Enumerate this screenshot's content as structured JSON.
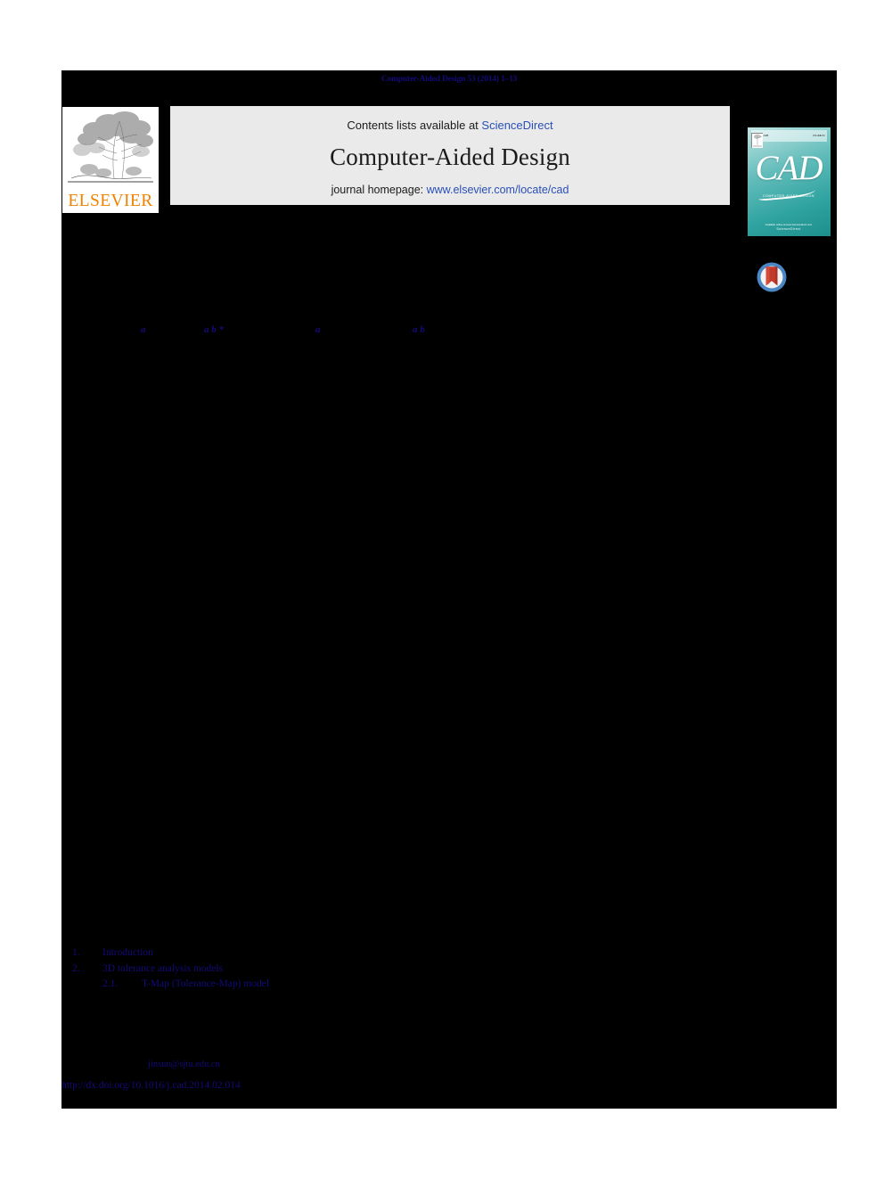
{
  "running_head": "Computer-Aided Design 53 (2014) 1–13",
  "masthead": {
    "contents_prefix": "Contents lists available at ",
    "sciencedirect_link": "ScienceDirect",
    "journal_title": "Computer-Aided Design",
    "homepage_prefix": "journal homepage: ",
    "homepage_link": "www.elsevier.com/locate/cad",
    "elsevier_wordmark": "ELSEVIER",
    "elsevier_logo_icon": "elsevier-tree-icon"
  },
  "cad_cover": {
    "title": "CAD",
    "subtitle": "COMPUTER-AIDED DESIGN",
    "top_left_note": "ISSN 0010-4485",
    "top_right_note": "VOLUME 53",
    "footer_line_1": "Available online at www.sciencedirect.com",
    "footer_line_2": "ScienceDirect"
  },
  "crossmark": {
    "icon": "crossmark-badge-icon",
    "ring_color": "#4a87c4",
    "ribbon_color": "#c0392b"
  },
  "authors": {
    "markers": [
      {
        "text": "a"
      },
      {
        "text": "a b *"
      },
      {
        "text": "a"
      },
      {
        "text": "a b"
      }
    ]
  },
  "contents": {
    "items": [
      {
        "number": "1.",
        "label": "Introduction",
        "level": 1
      },
      {
        "number": "2.",
        "label": "3D tolerance analysis models",
        "level": 1
      },
      {
        "number": "2.1.",
        "label": "T-Map (Tolerance-Map) model",
        "level": 2
      }
    ]
  },
  "footer": {
    "email": "jinsun@sjtu.edu.cn",
    "doi": "http://dx.doi.org/10.1016/j.cad.2014.02.014"
  },
  "colors": {
    "page_background": "#000000",
    "link_navy": "#140a78",
    "masthead_band": "#eaeaea",
    "elsevier_orange": "#ef8200",
    "web_link_blue": "#2a4fb7"
  }
}
